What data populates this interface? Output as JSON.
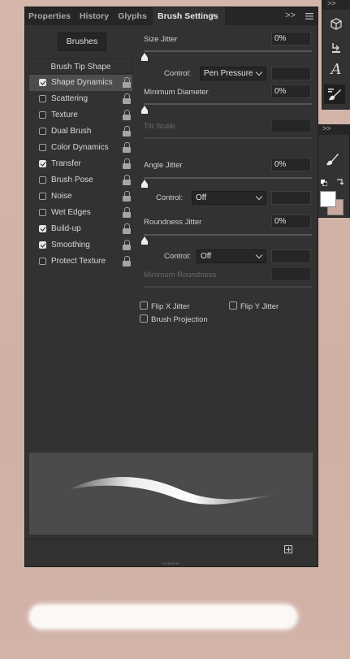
{
  "tabs": [
    {
      "label": "Properties"
    },
    {
      "label": "History"
    },
    {
      "label": "Glyphs"
    },
    {
      "label": "Brush Settings",
      "active": true
    }
  ],
  "panel_close": "×",
  "panel_expand": ">>",
  "brushes_button": "Brushes",
  "tip_shape": "Brush Tip Shape",
  "options": [
    {
      "label": "Shape Dynamics",
      "checked": true,
      "selected": true
    },
    {
      "label": "Scattering",
      "checked": false
    },
    {
      "label": "Texture",
      "checked": false
    },
    {
      "label": "Dual Brush",
      "checked": false
    },
    {
      "label": "Color Dynamics",
      "checked": false
    },
    {
      "label": "Transfer",
      "checked": true
    },
    {
      "label": "Brush Pose",
      "checked": false
    },
    {
      "label": "Noise",
      "checked": false
    },
    {
      "label": "Wet Edges",
      "checked": false
    },
    {
      "label": "Build-up",
      "checked": true
    },
    {
      "label": "Smoothing",
      "checked": true
    },
    {
      "label": "Protect Texture",
      "checked": false
    }
  ],
  "settings": {
    "size_jitter": {
      "label": "Size Jitter",
      "value": "0%",
      "slider": 0
    },
    "control1": {
      "label": "Control:",
      "value": "Pen Pressure"
    },
    "min_diameter": {
      "label": "Minimum Diameter",
      "value": "0%",
      "slider": 0
    },
    "tilt_scale": {
      "label": "Tilt Scale"
    },
    "angle_jitter": {
      "label": "Angle Jitter",
      "value": "0%",
      "slider": 0
    },
    "control2": {
      "label": "Control:",
      "value": "Off"
    },
    "roundness_jitter": {
      "label": "Roundness Jitter",
      "value": "0%",
      "slider": 0
    },
    "control3": {
      "label": "Control:",
      "value": "Off"
    },
    "min_roundness": {
      "label": "Minimum Roundness"
    },
    "flip_x": {
      "label": "Flip X Jitter",
      "checked": false
    },
    "flip_y": {
      "label": "Flip Y Jitter",
      "checked": false
    },
    "projection": {
      "label": "Brush Projection",
      "checked": false
    }
  },
  "dock_expand": ">>",
  "colors": {
    "foreground": "#ffffff",
    "background": "#c8a9a0",
    "canvas": "#d3b4a9"
  }
}
